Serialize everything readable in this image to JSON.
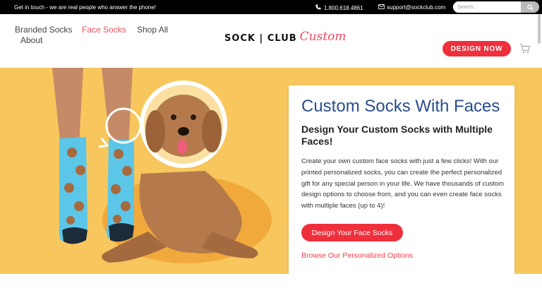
{
  "topbar": {
    "tagline": "Get in touch - we are real people who answer the phone!",
    "phone": "1.800.618.4861",
    "email": "support@sockclub.com",
    "search_placeholder": "Search..."
  },
  "nav": {
    "items": [
      {
        "label": "Branded Socks"
      },
      {
        "label": "About"
      },
      {
        "label": "Face Socks"
      },
      {
        "label": "Shop All"
      }
    ]
  },
  "logo": {
    "primary": "SOCK | CLUB",
    "script": "Custom"
  },
  "header": {
    "design_now_label": "DESIGN NOW"
  },
  "hero": {
    "title": "Custom Socks With Faces",
    "subtitle": "Design Your Custom Socks with Multiple Faces!",
    "body": "Create your own custom face socks with just a few clicks! With our printed personalized socks, you can create the perfect personalized gift for any special person in your life. We have thousands of custom design options to choose from, and you can even create face socks with multiple faces (up to 4)!",
    "primary_button_label": "Design Your Face Socks",
    "secondary_link_label": "Browse Our Personalized Options"
  },
  "colors": {
    "accent_red": "#ef2f3c",
    "hero_yellow": "#f7c75e",
    "title_blue": "#2a4d8a",
    "sock_blue": "#5bc6e8"
  },
  "icons": {
    "phone": "phone-icon",
    "email": "envelope-icon",
    "search": "search-icon",
    "cart": "cart-icon"
  }
}
